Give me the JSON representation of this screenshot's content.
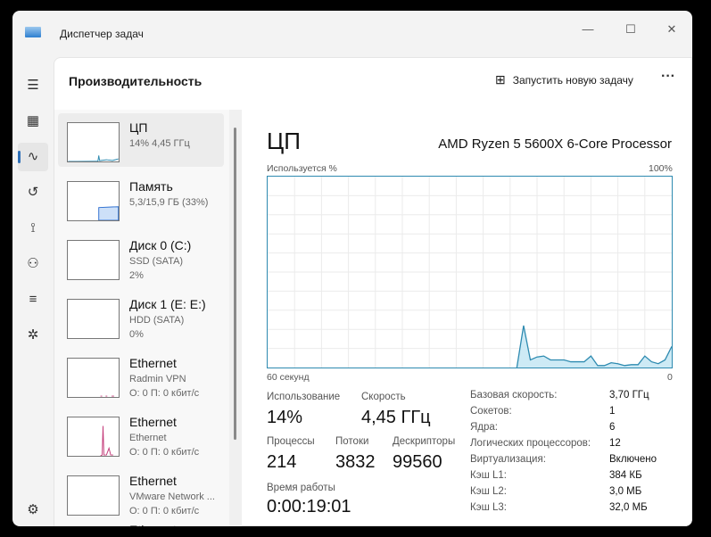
{
  "window": {
    "title": "Диспетчер задач",
    "minimize": "—",
    "maximize": "☐",
    "close": "✕"
  },
  "rail": [
    {
      "icon": "hamburger-icon",
      "g": "☰"
    },
    {
      "icon": "processes-icon",
      "g": "▦"
    },
    {
      "icon": "performance-icon",
      "g": "∿",
      "active": true
    },
    {
      "icon": "history-icon",
      "g": "↺"
    },
    {
      "icon": "startup-icon",
      "g": "⟟"
    },
    {
      "icon": "users-icon",
      "g": "⚇"
    },
    {
      "icon": "details-icon",
      "g": "≡"
    },
    {
      "icon": "services-icon",
      "g": "✲"
    },
    {
      "icon": "settings-icon",
      "g": "⚙"
    }
  ],
  "header": {
    "title": "Производительность",
    "run_task": "Запустить новую задачу",
    "more": "···"
  },
  "list": [
    {
      "name": "ЦП",
      "sub1": "14% 4,45 ГГц",
      "sub2": ""
    },
    {
      "name": "Память",
      "sub1": "5,3/15,9 ГБ (33%)",
      "sub2": ""
    },
    {
      "name": "Диск 0 (C:)",
      "sub1": "SSD (SATA)",
      "sub2": "2%"
    },
    {
      "name": "Диск 1 (E: E:)",
      "sub1": "HDD (SATA)",
      "sub2": "0%"
    },
    {
      "name": "Ethernet",
      "sub1": "Radmin VPN",
      "sub2": "О: 0 П: 0 кбит/с"
    },
    {
      "name": "Ethernet",
      "sub1": "Ethernet",
      "sub2": "О: 0 П: 0 кбит/с"
    },
    {
      "name": "Ethernet",
      "sub1": "VMware Network ...",
      "sub2": "О: 0 П: 0 кбит/с"
    },
    {
      "name": "Ethernet",
      "sub1": "",
      "sub2": ""
    }
  ],
  "main": {
    "title": "ЦП",
    "processor": "AMD Ryzen 5 5600X 6-Core Processor",
    "graph_label": "Используется %",
    "graph_max": "100%",
    "graph_left": "60 секунд",
    "graph_right": "0",
    "usage_label": "Использование",
    "usage": "14%",
    "speed_label": "Скорость",
    "speed": "4,45 ГГц",
    "proc_label": "Процессы",
    "proc": "214",
    "threads_label": "Потоки",
    "threads": "3832",
    "handles_label": "Дескрипторы",
    "handles": "99560",
    "uptime_label": "Время работы",
    "uptime": "0:00:19:01",
    "details": [
      [
        "Базовая скорость:",
        "3,70 ГГц"
      ],
      [
        "Сокетов:",
        "1"
      ],
      [
        "Ядра:",
        "6"
      ],
      [
        "Логических процессоров:",
        "12"
      ],
      [
        "Виртуализация:",
        "Включено"
      ],
      [
        "Кэш L1:",
        "384 КБ"
      ],
      [
        "Кэш L2:",
        "3,0 МБ"
      ],
      [
        "Кэш L3:",
        "32,0 МБ"
      ]
    ]
  },
  "chart_data": {
    "type": "area",
    "title": "Используется %",
    "xlabel": "60 секунд",
    "ylim": [
      0,
      100
    ],
    "xlim": [
      -60,
      0
    ],
    "x": [
      -23,
      -22,
      -21,
      -20,
      -19,
      -18,
      -17,
      -16,
      -15,
      -14,
      -13,
      -12,
      -11,
      -10,
      -9,
      -8,
      -7,
      -6,
      -5,
      -4,
      -3,
      -2,
      -1,
      0
    ],
    "values": [
      0,
      22,
      4,
      5.5,
      6,
      4,
      4,
      4,
      3,
      3,
      3,
      6,
      1,
      1,
      2.5,
      2,
      1,
      1.5,
      1.5,
      6,
      3,
      2,
      4,
      11
    ],
    "color": "#2d8ab0"
  }
}
